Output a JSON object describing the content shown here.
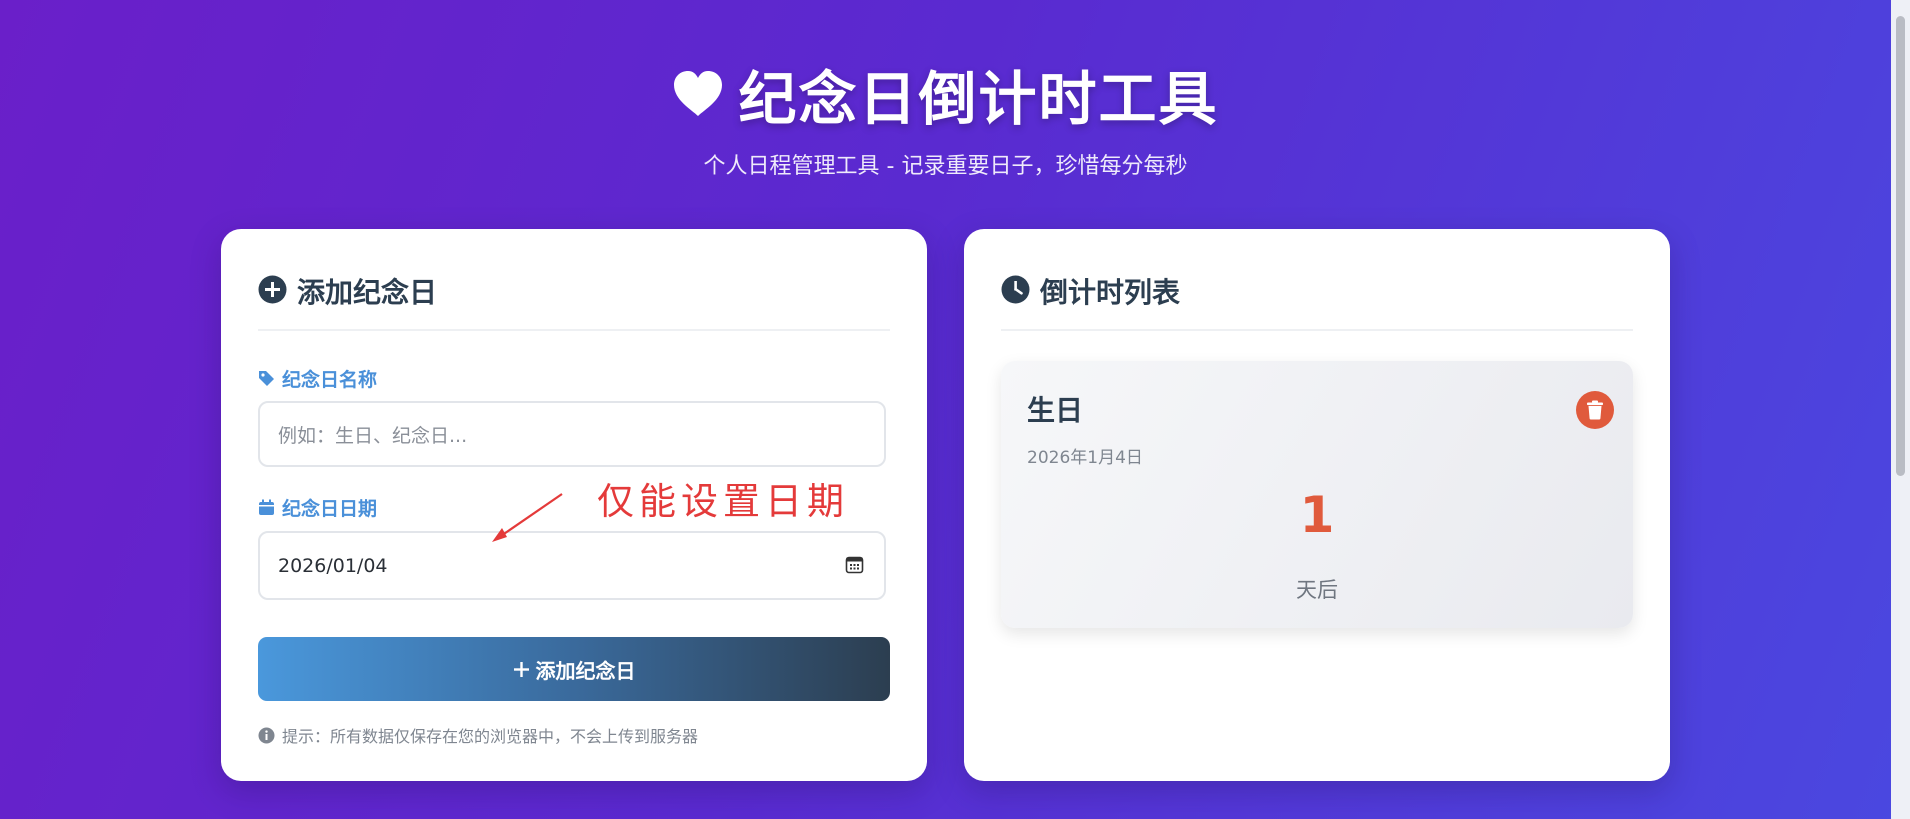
{
  "header": {
    "title": "纪念日倒计时工具",
    "subtitle": "个人日程管理工具 - 记录重要日子，珍惜每分每秒"
  },
  "add_panel": {
    "heading": "添加纪念日",
    "name_label": "纪念日名称",
    "name_placeholder": "例如：生日、纪念日...",
    "date_label": "纪念日日期",
    "date_value": "2026/01/04",
    "submit_label": "添加纪念日",
    "hint": "提示：所有数据仅保存在您的浏览器中，不会上传到服务器"
  },
  "annotation": {
    "text": "仅能设置日期"
  },
  "list_panel": {
    "heading": "倒计时列表",
    "items": [
      {
        "name": "生日",
        "date": "2026年1月4日",
        "days": "1",
        "unit": "天后"
      }
    ]
  },
  "colors": {
    "accent_blue": "#4a90d9",
    "dark": "#2c3e50",
    "danger": "#e05a3c",
    "annotation_red": "#e43a3a"
  },
  "icons": {
    "title": "heart-icon",
    "add_heading": "plus-circle-icon",
    "name_label": "tag-icon",
    "date_label": "calendar-icon",
    "date_picker": "calendar-picker-icon",
    "submit": "plus-icon",
    "hint": "info-icon",
    "list_heading": "clock-icon",
    "delete": "trash-icon"
  }
}
